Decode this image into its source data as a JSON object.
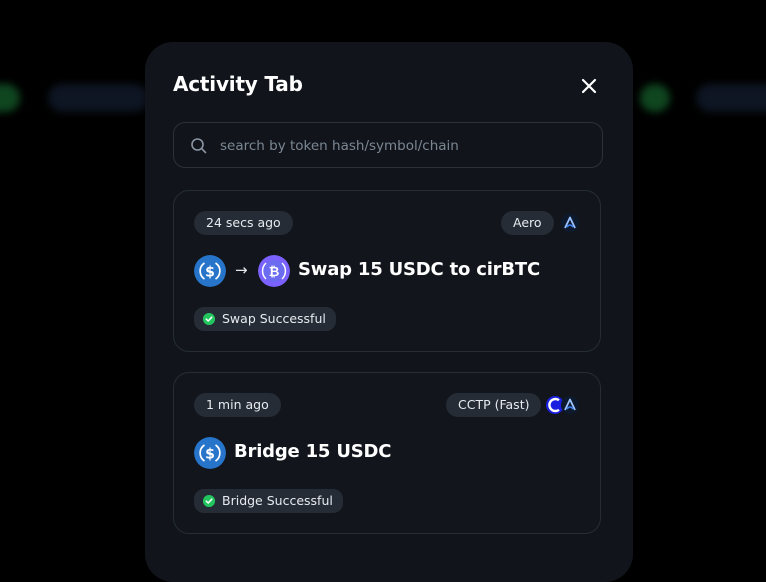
{
  "modal": {
    "title": "Activity Tab",
    "search_placeholder": "search by token hash/symbol/chain"
  },
  "activities": [
    {
      "time": "24 secs ago",
      "protocol": "Aero",
      "title": "Swap 15 USDC to cirBTC",
      "status": "Swap Successful",
      "from_token": "usdc-icon",
      "to_token": "cirbtc-icon"
    },
    {
      "time": "1 min ago",
      "protocol": "CCTP (Fast)",
      "title": "Bridge 15 USDC",
      "status": "Bridge Successful",
      "from_token": "usdc-icon"
    }
  ],
  "colors": {
    "panel": "#11151b",
    "usdc": "#2775ca",
    "cirbtc": "#7b61ff",
    "success": "#22c55e"
  }
}
